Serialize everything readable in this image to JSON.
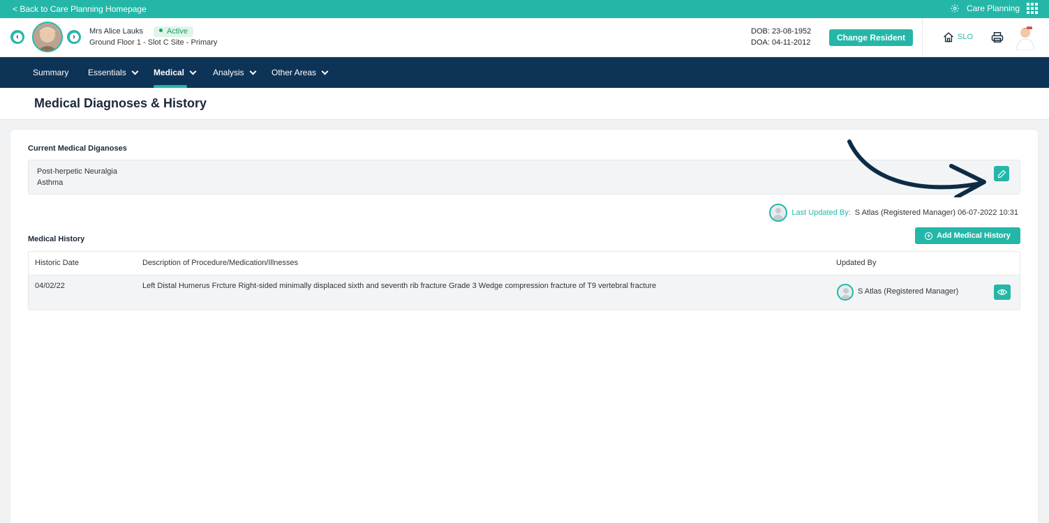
{
  "topbar": {
    "back_label": "< Back to Care Planning Homepage",
    "app_label": "Care Planning"
  },
  "resident": {
    "name": "Mrs Alice Lauks",
    "status": "Active",
    "location": "Ground Floor 1 - Slot C Site - Primary",
    "dob": "DOB: 23-08-1952",
    "doa": "DOA: 04-11-2012",
    "change_label": "Change Resident",
    "home_code": "SLO"
  },
  "nav": {
    "items": [
      {
        "label": "Summary"
      },
      {
        "label": "Essentials"
      },
      {
        "label": "Medical"
      },
      {
        "label": "Analysis"
      },
      {
        "label": "Other Areas"
      }
    ]
  },
  "page": {
    "title": "Medical Diagnoses & History"
  },
  "diagnoses": {
    "section_title": "Current Medical Diganoses",
    "items": [
      "Post-herpetic Neuralgia",
      "Asthma"
    ],
    "last_updated_label": "Last Updated By:",
    "last_updated_value": "S Atlas (Registered Manager) 06-07-2022 10:31"
  },
  "history": {
    "section_title": "Medical History",
    "add_label": "Add Medical History",
    "columns": [
      "Historic Date",
      "Description of Procedure/Medication/Illnesses",
      "Updated By"
    ],
    "rows": [
      {
        "date": "04/02/22",
        "description": "Left Distal Humerus Frcture Right-sided minimally displaced sixth and seventh rib fracture Grade 3 Wedge compression fracture of T9 vertebral fracture",
        "updated_by": "S Atlas (Registered Manager)"
      }
    ]
  },
  "colors": {
    "accent": "#24b7a8",
    "navy": "#0d3356",
    "background": "#f1f2f4"
  }
}
